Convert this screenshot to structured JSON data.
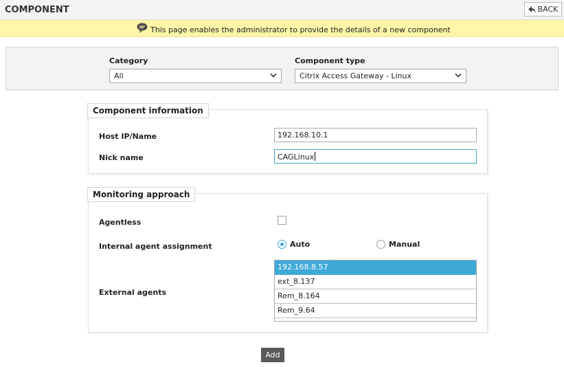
{
  "header": {
    "title": "COMPONENT",
    "back_label": "BACK"
  },
  "info": {
    "message": "This page enables the administrator to provide the details of a new component"
  },
  "selectors": {
    "category_label": "Category",
    "category_value": "All",
    "component_type_label": "Component type",
    "component_type_value": "Citrix Access Gateway - Linux"
  },
  "component_info": {
    "legend": "Component information",
    "host_label": "Host IP/Name",
    "host_value": "192.168.10.1",
    "nick_label": "Nick name",
    "nick_value": "CAGLinux"
  },
  "monitoring": {
    "legend": "Monitoring approach",
    "agentless_label": "Agentless",
    "agentless_checked": false,
    "assignment_label": "Internal agent assignment",
    "assignment_options": [
      "Auto",
      "Manual"
    ],
    "assignment_selected": "Auto",
    "external_label": "External agents",
    "external_agents": [
      "192.168.8.57",
      "ext_8.137",
      "Rem_8.164",
      "Rem_9.64"
    ],
    "external_selected": "192.168.8.57"
  },
  "actions": {
    "add_label": "Add"
  },
  "colors": {
    "info_bar": "#fdf5a7",
    "accent": "#3fa9d8",
    "add_button": "#595959"
  },
  "icons": {
    "back": "back-arrow-icon",
    "info": "speech-bubble-icon",
    "dropdown": "chevron-down-icon"
  }
}
